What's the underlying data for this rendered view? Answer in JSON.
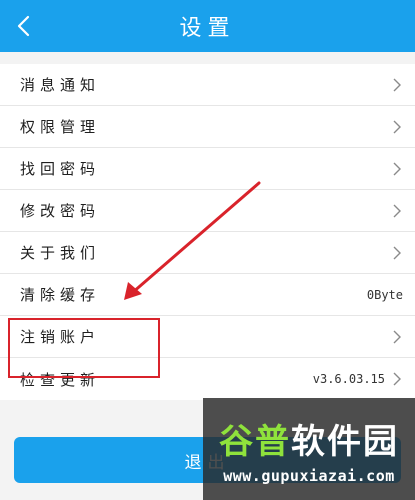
{
  "header": {
    "title": "设置"
  },
  "settings": {
    "items": [
      {
        "label": "消息通知",
        "value": ""
      },
      {
        "label": "权限管理",
        "value": ""
      },
      {
        "label": "找回密码",
        "value": ""
      },
      {
        "label": "修改密码",
        "value": ""
      },
      {
        "label": "关于我们",
        "value": ""
      },
      {
        "label": "清除缓存",
        "value": "0Byte"
      },
      {
        "label": "注销账户",
        "value": ""
      },
      {
        "label": "检查更新",
        "value": "v3.6.03.15"
      }
    ]
  },
  "footer": {
    "logout_label": "退出"
  },
  "watermark": {
    "title_a": "谷普",
    "title_b": "软件园",
    "url": "www.gupuxiazai.com"
  },
  "colors": {
    "accent": "#1aa1ec",
    "annotation": "#d9232b",
    "watermark_green": "#8fe23c"
  },
  "icons": {
    "back": "chevron-left-icon",
    "row": "chevron-right-icon"
  }
}
